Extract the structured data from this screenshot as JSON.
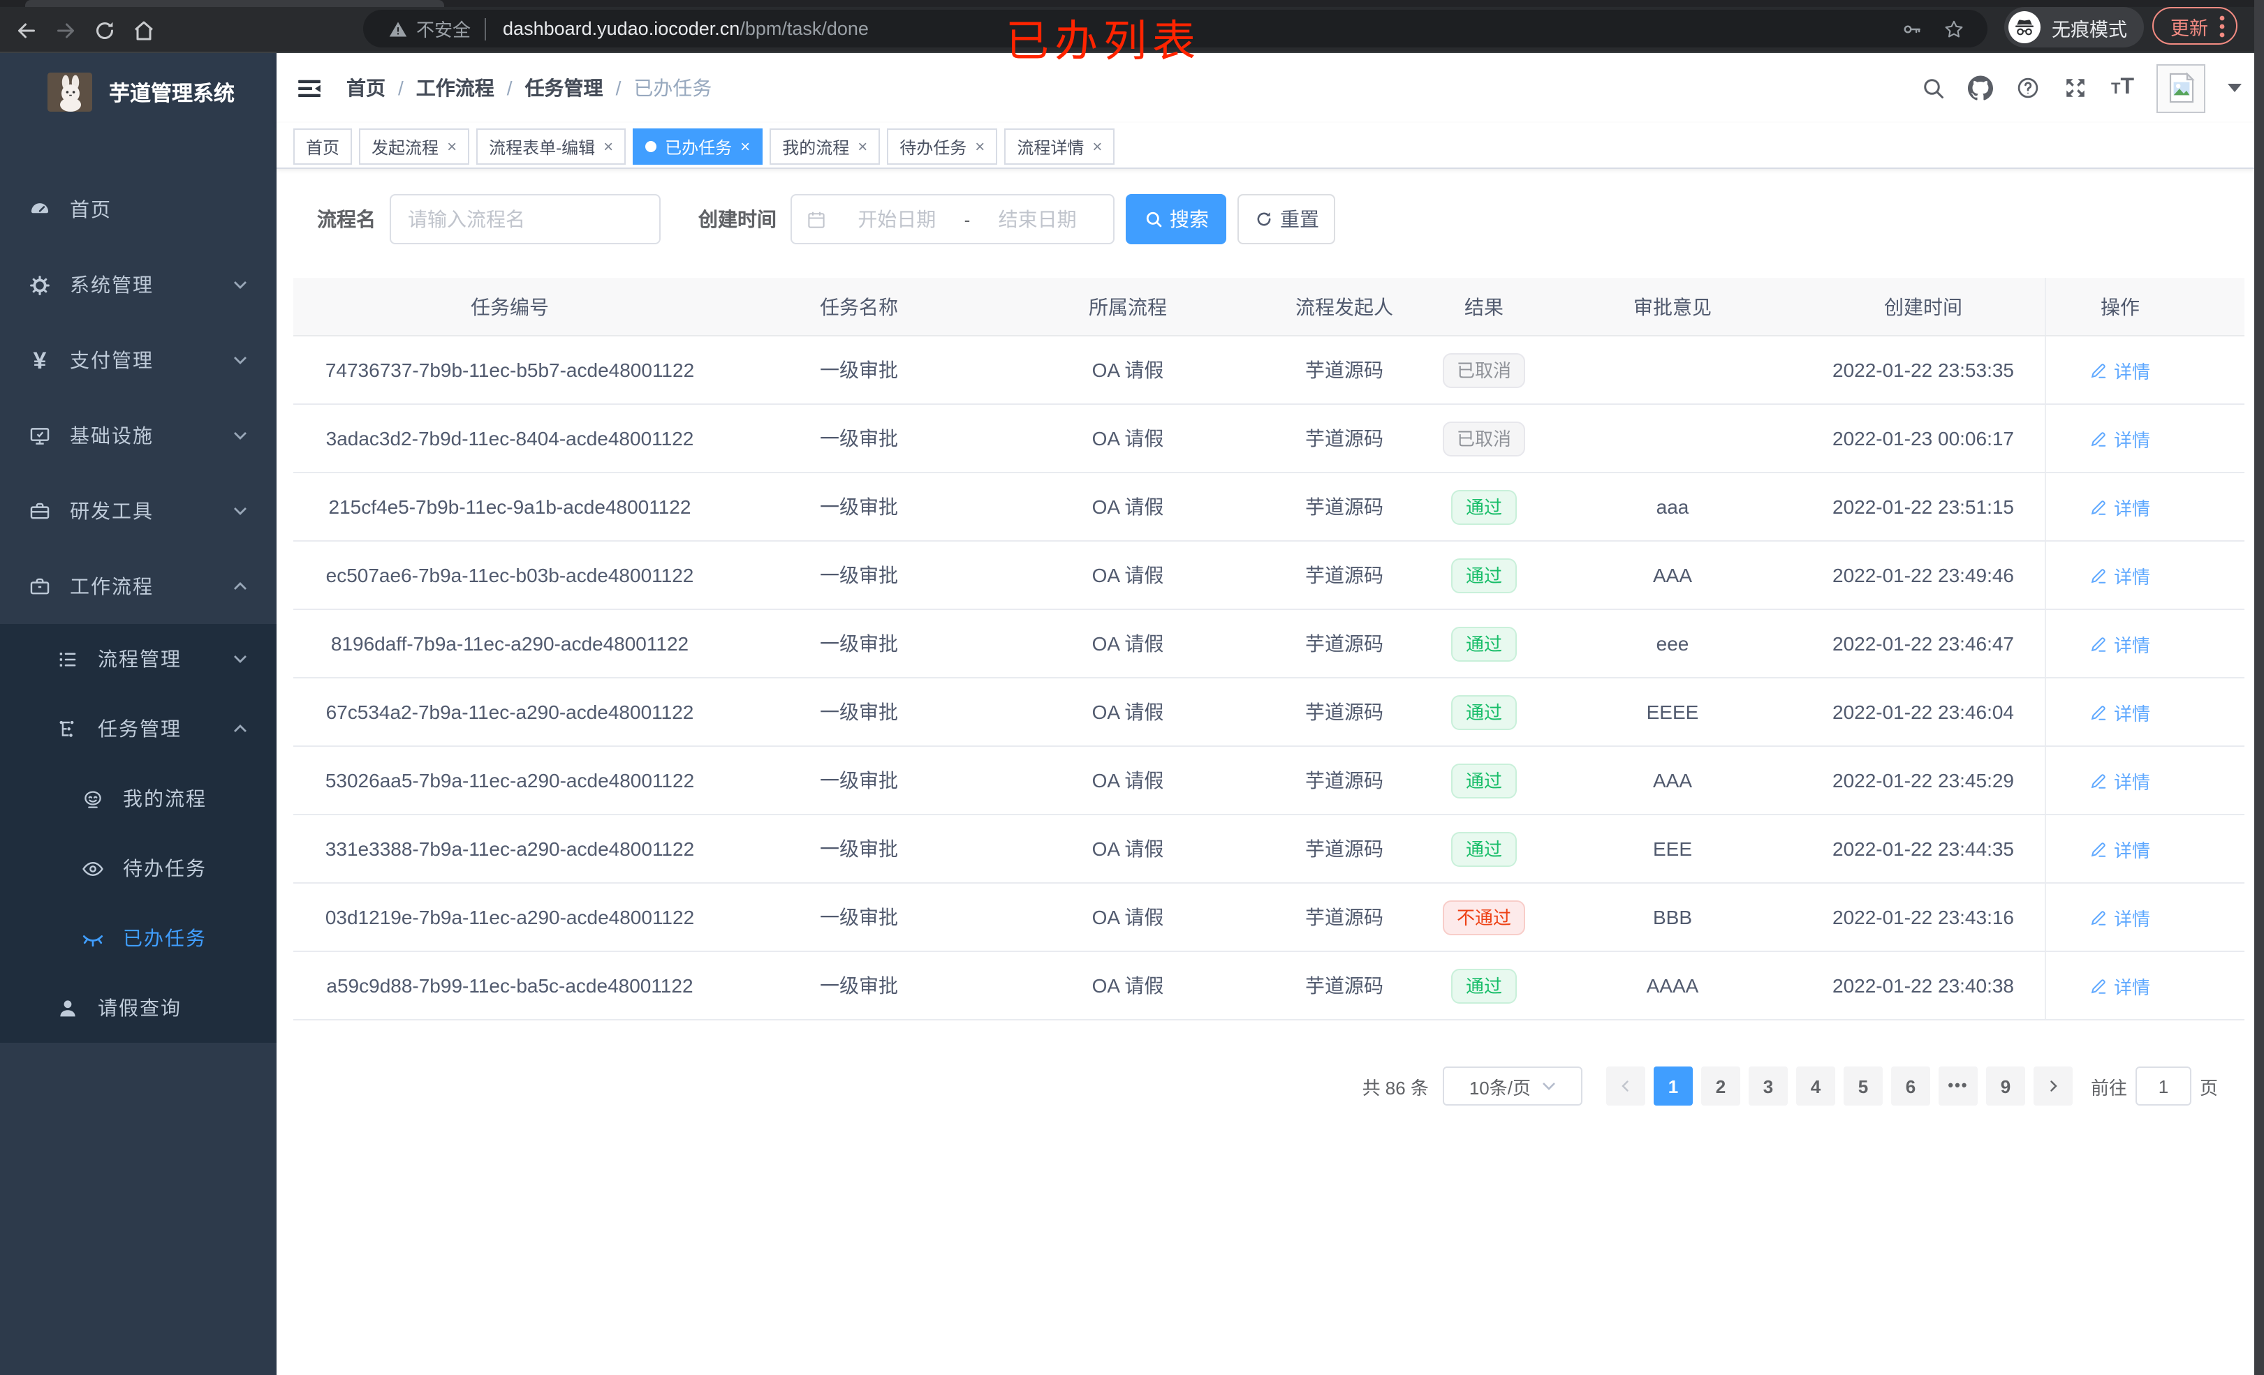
{
  "annotation": "已办列表",
  "browser": {
    "security_label": "不安全",
    "url_host": "dashboard.yudao.iocoder.cn",
    "url_path": "/bpm/task/done",
    "incognito_label": "无痕模式",
    "update_label": "更新"
  },
  "sidebar": {
    "app_title": "芋道管理系统",
    "items": [
      {
        "label": "首页",
        "icon": "dashboard-icon",
        "level": 1,
        "sub": false,
        "chevron": "",
        "active": false
      },
      {
        "label": "系统管理",
        "icon": "gear-icon",
        "level": 1,
        "sub": false,
        "chevron": "down",
        "active": false
      },
      {
        "label": "支付管理",
        "icon": "yen-icon",
        "level": 1,
        "sub": false,
        "chevron": "down",
        "active": false
      },
      {
        "label": "基础设施",
        "icon": "monitor-icon",
        "level": 1,
        "sub": false,
        "chevron": "down",
        "active": false
      },
      {
        "label": "研发工具",
        "icon": "toolbox-icon",
        "level": 1,
        "sub": false,
        "chevron": "down",
        "active": false
      },
      {
        "label": "工作流程",
        "icon": "briefcase-icon",
        "level": 1,
        "sub": false,
        "chevron": "up",
        "active": false
      },
      {
        "label": "流程管理",
        "icon": "list-icon",
        "level": 2,
        "sub": true,
        "chevron": "down",
        "active": false
      },
      {
        "label": "任务管理",
        "icon": "flow-icon",
        "level": 2,
        "sub": true,
        "chevron": "up",
        "active": false
      },
      {
        "label": "我的流程",
        "icon": "robot-icon",
        "level": 3,
        "sub": true,
        "chevron": "",
        "active": false
      },
      {
        "label": "待办任务",
        "icon": "eye-icon",
        "level": 3,
        "sub": true,
        "chevron": "",
        "active": false
      },
      {
        "label": "已办任务",
        "icon": "eye-closed-icon",
        "level": 3,
        "sub": true,
        "chevron": "",
        "active": true
      },
      {
        "label": "请假查询",
        "icon": "user-icon",
        "level": 2,
        "sub": true,
        "chevron": "",
        "active": false
      }
    ]
  },
  "breadcrumb": {
    "items": [
      "首页",
      "工作流程",
      "任务管理",
      "已办任务"
    ],
    "separator": "/"
  },
  "tabs": [
    {
      "label": "首页",
      "closable": false,
      "active": false
    },
    {
      "label": "发起流程",
      "closable": true,
      "active": false
    },
    {
      "label": "流程表单-编辑",
      "closable": true,
      "active": false
    },
    {
      "label": "已办任务",
      "closable": true,
      "active": true
    },
    {
      "label": "我的流程",
      "closable": true,
      "active": false
    },
    {
      "label": "待办任务",
      "closable": true,
      "active": false
    },
    {
      "label": "流程详情",
      "closable": true,
      "active": false
    }
  ],
  "filters": {
    "name_label": "流程名",
    "name_placeholder": "请输入流程名",
    "time_label": "创建时间",
    "start_placeholder": "开始日期",
    "range_separator": "-",
    "end_placeholder": "结束日期",
    "search_label": "搜索",
    "reset_label": "重置"
  },
  "table": {
    "columns": [
      "任务编号",
      "任务名称",
      "所属流程",
      "流程发起人",
      "结果",
      "审批意见",
      "创建时间",
      "操作"
    ],
    "detail_label": "详情",
    "rows": [
      {
        "id": "74736737-7b9b-11ec-b5b7-acde48001122",
        "name": "一级审批",
        "process": "OA 请假",
        "starter": "芋道源码",
        "result": "已取消",
        "result_type": "info",
        "comment": "",
        "created": "2022-01-22 23:53:35"
      },
      {
        "id": "3adac3d2-7b9d-11ec-8404-acde48001122",
        "name": "一级审批",
        "process": "OA 请假",
        "starter": "芋道源码",
        "result": "已取消",
        "result_type": "info",
        "comment": "",
        "created": "2022-01-23 00:06:17"
      },
      {
        "id": "215cf4e5-7b9b-11ec-9a1b-acde48001122",
        "name": "一级审批",
        "process": "OA 请假",
        "starter": "芋道源码",
        "result": "通过",
        "result_type": "success",
        "comment": "aaa",
        "created": "2022-01-22 23:51:15"
      },
      {
        "id": "ec507ae6-7b9a-11ec-b03b-acde48001122",
        "name": "一级审批",
        "process": "OA 请假",
        "starter": "芋道源码",
        "result": "通过",
        "result_type": "success",
        "comment": "AAA",
        "created": "2022-01-22 23:49:46"
      },
      {
        "id": "8196daff-7b9a-11ec-a290-acde48001122",
        "name": "一级审批",
        "process": "OA 请假",
        "starter": "芋道源码",
        "result": "通过",
        "result_type": "success",
        "comment": "eee",
        "created": "2022-01-22 23:46:47"
      },
      {
        "id": "67c534a2-7b9a-11ec-a290-acde48001122",
        "name": "一级审批",
        "process": "OA 请假",
        "starter": "芋道源码",
        "result": "通过",
        "result_type": "success",
        "comment": "EEEE",
        "created": "2022-01-22 23:46:04"
      },
      {
        "id": "53026aa5-7b9a-11ec-a290-acde48001122",
        "name": "一级审批",
        "process": "OA 请假",
        "starter": "芋道源码",
        "result": "通过",
        "result_type": "success",
        "comment": "AAA",
        "created": "2022-01-22 23:45:29"
      },
      {
        "id": "331e3388-7b9a-11ec-a290-acde48001122",
        "name": "一级审批",
        "process": "OA 请假",
        "starter": "芋道源码",
        "result": "通过",
        "result_type": "success",
        "comment": "EEE",
        "created": "2022-01-22 23:44:35"
      },
      {
        "id": "03d1219e-7b9a-11ec-a290-acde48001122",
        "name": "一级审批",
        "process": "OA 请假",
        "starter": "芋道源码",
        "result": "不通过",
        "result_type": "danger",
        "comment": "BBB",
        "created": "2022-01-22 23:43:16"
      },
      {
        "id": "a59c9d88-7b99-11ec-ba5c-acde48001122",
        "name": "一级审批",
        "process": "OA 请假",
        "starter": "芋道源码",
        "result": "通过",
        "result_type": "success",
        "comment": "AAAA",
        "created": "2022-01-22 23:40:38"
      }
    ]
  },
  "pagination": {
    "total_text": "共 86 条",
    "page_size": "10条/页",
    "pages": [
      "1",
      "2",
      "3",
      "4",
      "5",
      "6",
      "•••",
      "9"
    ],
    "active_page": "1",
    "goto_label": "前往",
    "goto_value": "1",
    "page_label": "页"
  },
  "colors": {
    "primary": "#409eff",
    "success_text": "#17bd68",
    "danger_text": "#ed4014",
    "info_text": "#909399",
    "sidebar_bg": "#2d3a4b",
    "submenu_bg": "#1f2d3d",
    "annotation_red": "#ff2400",
    "update_chip": "#f28b82"
  }
}
